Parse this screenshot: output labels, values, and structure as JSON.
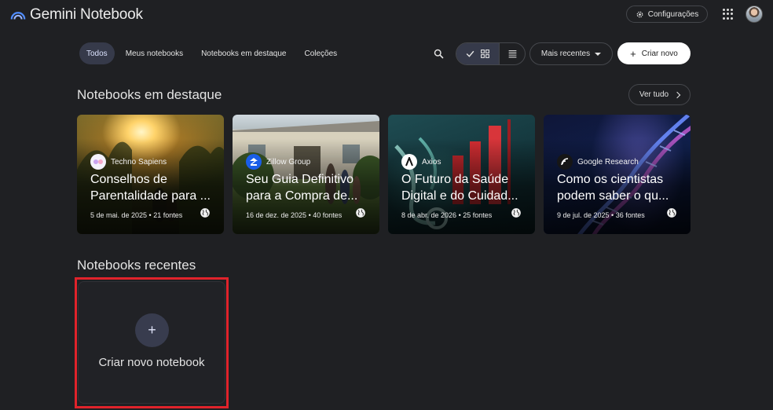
{
  "app": {
    "title": "Gemini Notebook"
  },
  "header": {
    "settings_label": "Configurações"
  },
  "filters": {
    "tabs": [
      {
        "label": "Todos",
        "active": true
      },
      {
        "label": "Meus notebooks",
        "active": false
      },
      {
        "label": "Notebooks em destaque",
        "active": false
      },
      {
        "label": "Coleções",
        "active": false
      }
    ],
    "view_mode": "grid",
    "sort_label": "Mais recentes",
    "create_label": "Criar novo"
  },
  "featured": {
    "title": "Notebooks em destaque",
    "see_all_label": "Ver tudo",
    "cards": [
      {
        "source": "Techno Sapiens",
        "title_line1": "Conselhos de",
        "title_line2": "Parentalidade para ...",
        "meta": "5 de mai. de 2025 • 21 fontes",
        "icon": "techno-sapiens-logo"
      },
      {
        "source": "Zillow Group",
        "title_line1": "Seu Guia Definitivo",
        "title_line2": "para a Compra de...",
        "meta": "16 de dez. de 2025 • 40 fontes",
        "icon": "zillow-logo"
      },
      {
        "source": "Axios",
        "title_line1": "O Futuro da Saúde",
        "title_line2": "Digital e do Cuidad...",
        "meta": "8 de abr. de 2026 • 25 fontes",
        "icon": "axios-logo"
      },
      {
        "source": "Google Research",
        "title_line1": "Como os cientistas",
        "title_line2": "podem saber o qu...",
        "meta": "9 de jul. de 2025 • 36 fontes",
        "icon": "google-research-logo"
      }
    ]
  },
  "recent": {
    "title": "Notebooks recentes",
    "new_notebook_label": "Criar novo notebook",
    "highlight_color": "#e0232b"
  },
  "colors": {
    "background": "#1f2023",
    "accent": "#363a4a"
  }
}
